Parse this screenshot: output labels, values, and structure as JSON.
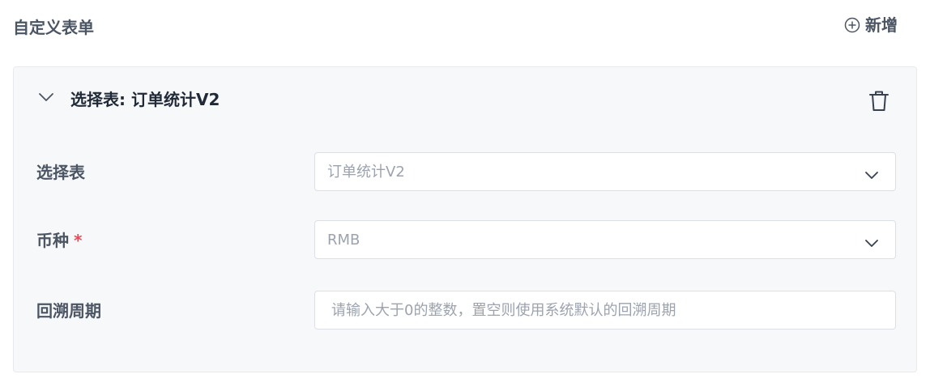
{
  "header": {
    "title": "自定义表单",
    "add_icon": "plus-circle-icon",
    "add_label": "新增"
  },
  "card": {
    "collapse_icon": "chevron-down-icon",
    "title": "选择表: 订单统计V2",
    "delete_icon": "trash-icon",
    "fields": [
      {
        "label": "选择表",
        "required": false,
        "type": "select",
        "value": "订单统计V2"
      },
      {
        "label": "币种",
        "required": true,
        "required_mark": "*",
        "type": "select",
        "value": "RMB"
      },
      {
        "label": "回溯周期",
        "required": false,
        "type": "input",
        "value": "",
        "placeholder": "请输入大于0的整数，置空则使用系统默认的回溯周期"
      }
    ]
  },
  "colors": {
    "label": "#4b5563",
    "title": "#1f2937",
    "placeholder": "#9ca3af",
    "required": "#e34d59",
    "card_bg": "#f7f8fa",
    "border": "#dcdfe6"
  }
}
